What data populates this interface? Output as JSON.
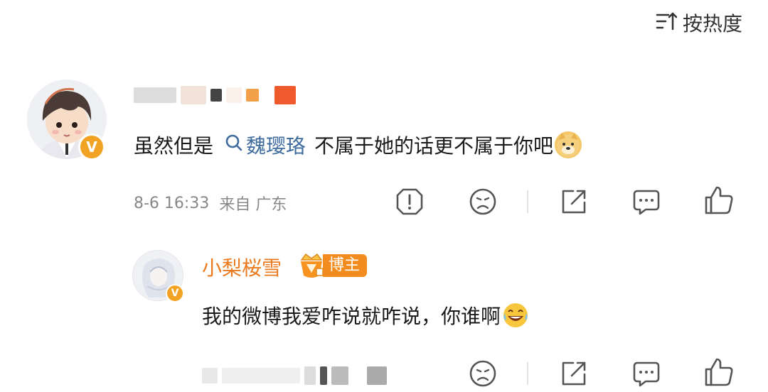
{
  "sort": {
    "label": "按热度",
    "icon": "sort-icon"
  },
  "comment": {
    "text_before": "虽然但是",
    "topic": "魏璎珞",
    "text_after": "不属于她的话更不属于你吧",
    "emoji": "doge-emoji",
    "time": "8-6 16:33",
    "location": "来自 广东"
  },
  "reply": {
    "username": "小梨桜雪",
    "badge": "博主",
    "text": "我的微博我爱咋说就咋说，你谁啊",
    "emoji": "laugh-cry-emoji"
  },
  "colors": {
    "topic": "#3f6c9e",
    "reply_name": "#eb7a1f",
    "badge": "#f28c1e",
    "verified": "#f3a323"
  },
  "icons": [
    "report-icon",
    "dislike-icon",
    "share-icon",
    "reply-icon",
    "like-icon"
  ]
}
